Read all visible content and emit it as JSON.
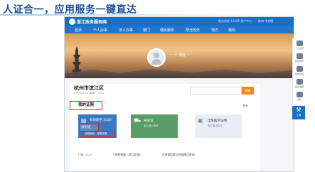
{
  "slide_title": "人证合一，应用服务一键直达",
  "app": {
    "brand": "浙江政务服务网",
    "hotline": "服务热线 12345  用户中心",
    "site_switch": "杭州  中文版"
  },
  "nav": [
    "首页",
    "个人办事",
    "法人办事",
    "部门",
    "便民服务",
    "阳光政务",
    "地方",
    "我的"
  ],
  "profile": {
    "username": "一 个 你好 一 "
  },
  "region": {
    "title": "杭州市滨江区",
    "date": "2019/01/01 星期二 2017 "
  },
  "search": {
    "button_label": "搜索"
  },
  "my_services": {
    "label": "我的证照",
    "more": "更多"
  },
  "tiles": [
    {
      "title": "身份证",
      "sub": "有效期至 2028",
      "highlighted": "身份证",
      "detail": "证照编号 · 查看详情"
    },
    {
      "title": "驾驶证",
      "sub": "浙江省公安厅"
    },
    {
      "title": "出生医学证明",
      "sub": "浙江省卫生厅"
    }
  ],
  "bottom_links": [
    "门诊（1-1）",
    "个体经营者（滨江区域）",
    "生育保险登记办理地点查询"
  ],
  "rail": [
    "个人主页",
    "我的办件",
    "我的证照",
    "我的收藏",
    "消息",
    "工具"
  ],
  "rail_active": "工具"
}
